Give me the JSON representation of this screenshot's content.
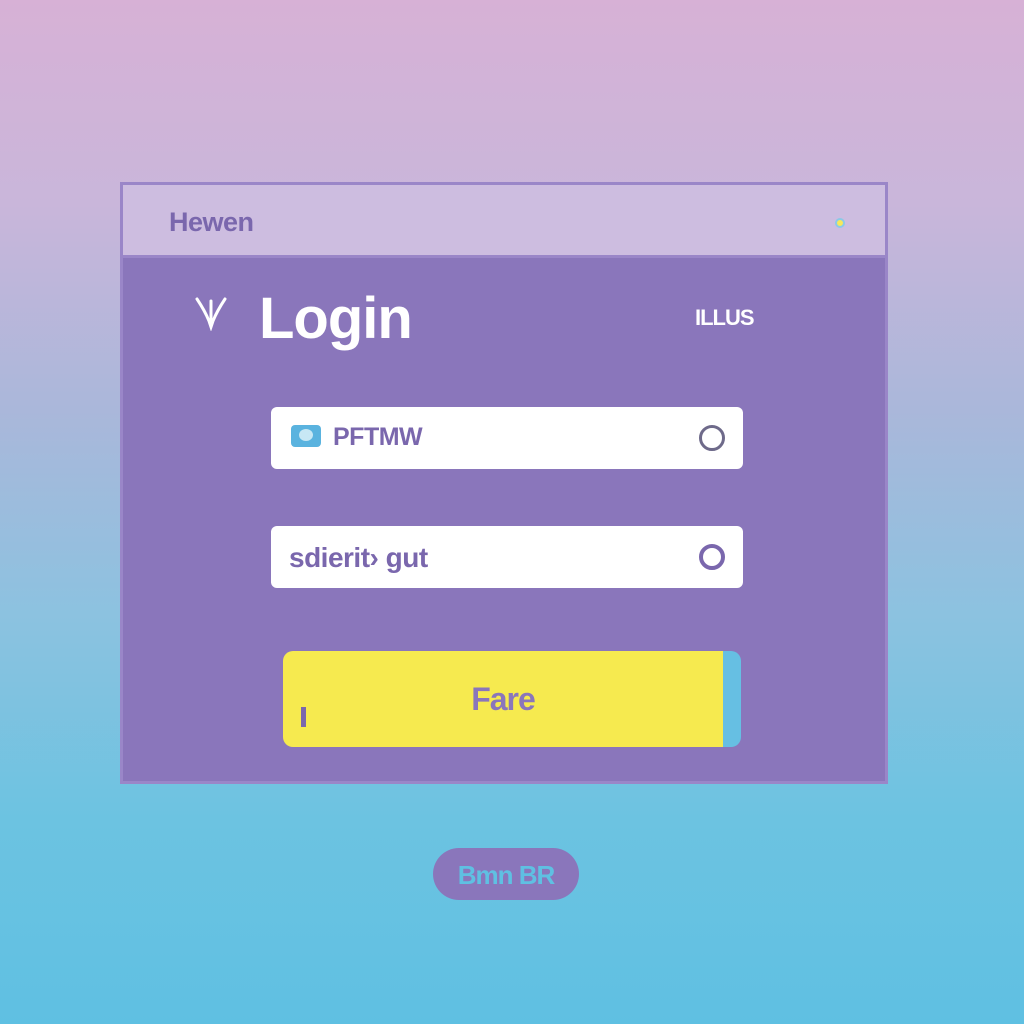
{
  "window": {
    "title": "Hewen"
  },
  "header": {
    "heading": "Login",
    "help_link": "ILLUS"
  },
  "form": {
    "username": {
      "value": "PFTMW",
      "icon": "user-card-icon"
    },
    "password": {
      "value": "sdierit› gut",
      "icon": "eye-icon"
    },
    "submit_label": "Fare"
  },
  "footer": {
    "pill_label": "Bmn BR"
  },
  "colors": {
    "panel": "#8a76bb",
    "titlebar": "#cdbde0",
    "accent_yellow": "#f6ea4f",
    "accent_blue": "#66bfe3",
    "text_purple": "#7a67ad"
  }
}
